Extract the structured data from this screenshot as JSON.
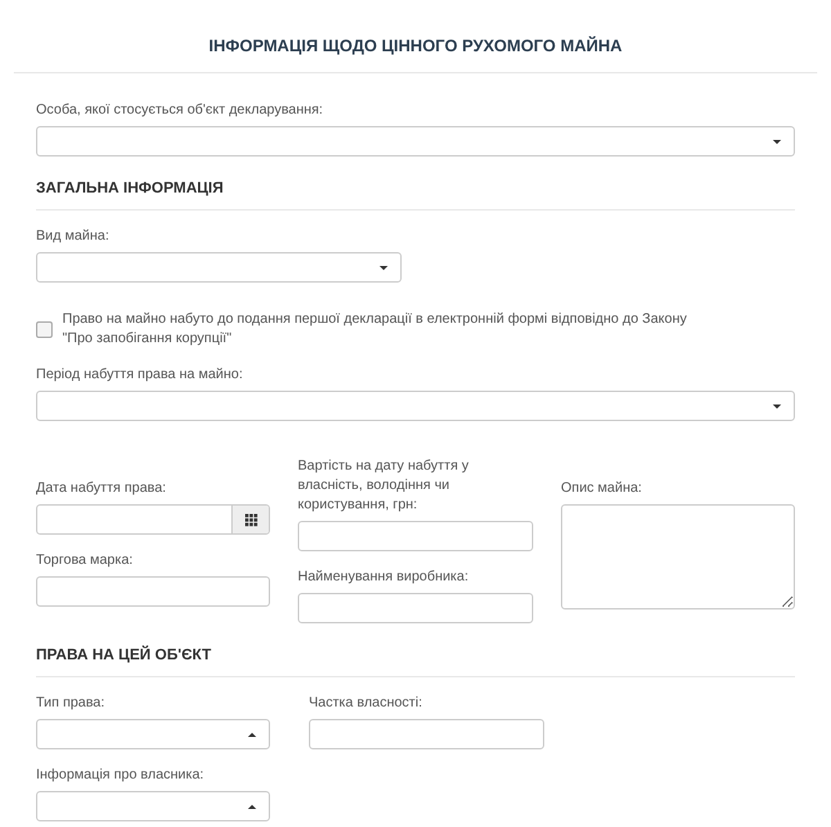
{
  "title": "ІНФОРМАЦІЯ ЩОДО ЦІННОГО РУХОМОГО МАЙНА",
  "person_field": {
    "label": "Особа, якої стосується об'єкт декларування:",
    "expanded": false
  },
  "general": {
    "heading": "ЗАГАЛЬНА ІНФОРМАЦІЯ",
    "property_type": {
      "label": "Вид майна:",
      "expanded": false
    },
    "acquired_before": {
      "label": "Право на майно набуто до подання першої декларації в електронній формі відповідно до Закону \"Про запобігання корупції\"",
      "checked": false
    },
    "period": {
      "label": "Період набуття права на майно:",
      "expanded": false
    },
    "acquisition_date": {
      "label": "Дата набуття права:"
    },
    "value": {
      "label": "Вартість на дату набуття у власність, володіння чи користування, грн:"
    },
    "description": {
      "label": "Опис майна:"
    },
    "brand": {
      "label": "Торгова марка:"
    },
    "manufacturer": {
      "label": "Найменування виробника:"
    }
  },
  "rights": {
    "heading": "ПРАВА НА ЦЕЙ ОБ'ЄКТ",
    "right_type": {
      "label": "Тип права:",
      "expanded": true
    },
    "share": {
      "label": "Частка власності:"
    },
    "owner_info": {
      "label": "Інформація про власника:",
      "expanded": true
    }
  }
}
